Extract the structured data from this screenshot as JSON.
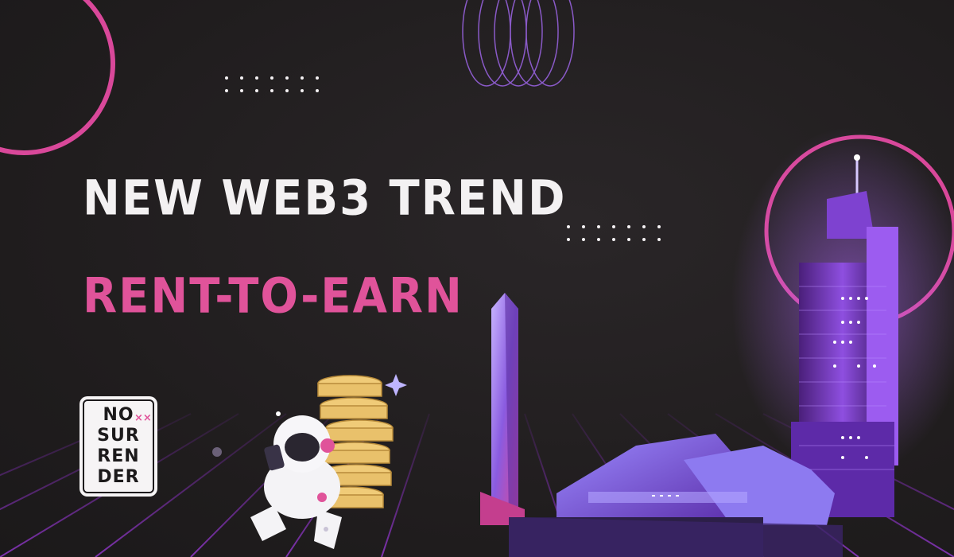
{
  "headline": "NEW WEB3 TREND",
  "subheadline": "RENT-TO-EARN",
  "badge": {
    "lines": [
      "NO",
      "SUR",
      "REN",
      "DER"
    ],
    "mark": "××"
  },
  "colors": {
    "background": "#231f20",
    "headline": "#f3f1f2",
    "accent_pink": "#e0539a",
    "grid_purple": "#7b2fa8",
    "building_purple": "#8f4fd6",
    "coin_gold": "#e9c16b"
  },
  "icons": [
    "astronaut-illustration",
    "coin-stack-illustration",
    "skyscraper-illustration",
    "sparkle-icon"
  ]
}
